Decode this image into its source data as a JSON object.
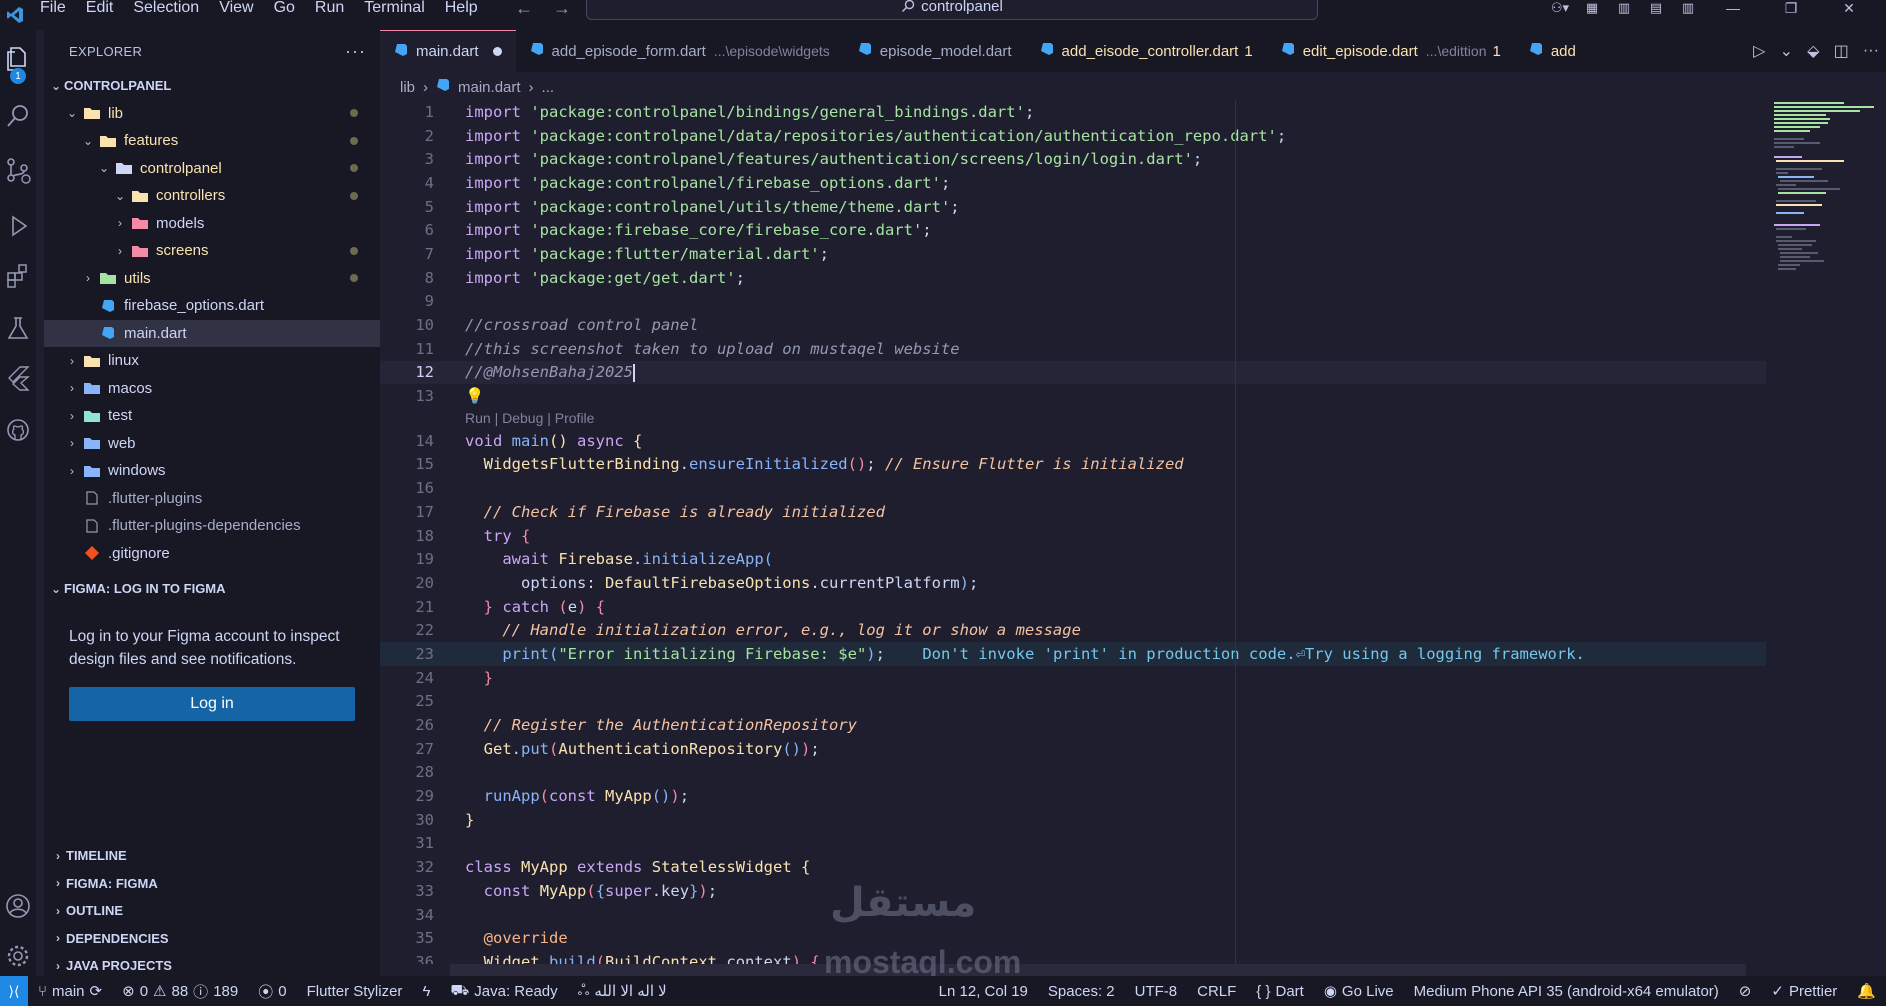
{
  "menu": [
    "File",
    "Edit",
    "Selection",
    "View",
    "Go",
    "Run",
    "Terminal",
    "Help"
  ],
  "command_center": "controlpanel",
  "activity_badge": "1",
  "explorer": {
    "title": "EXPLORER",
    "more": "···",
    "root": "CONTROLPANEL",
    "tree": [
      {
        "label": "lib",
        "depth": 0,
        "type": "folder",
        "open": true,
        "dot": true
      },
      {
        "label": "features",
        "depth": 1,
        "type": "folder",
        "open": true,
        "dot": true
      },
      {
        "label": "controlpanel",
        "depth": 2,
        "type": "folder",
        "open": true,
        "dot": true
      },
      {
        "label": "controllers",
        "depth": 3,
        "type": "folder",
        "open": true,
        "dot": true
      },
      {
        "label": "models",
        "depth": 3,
        "type": "folder",
        "open": false,
        "dot": false
      },
      {
        "label": "screens",
        "depth": 3,
        "type": "folder",
        "open": false,
        "dot": true
      },
      {
        "label": "utils",
        "depth": 1,
        "type": "folder",
        "open": false,
        "dot": true
      },
      {
        "label": "firebase_options.dart",
        "depth": 1,
        "type": "dart",
        "dot": false
      },
      {
        "label": "main.dart",
        "depth": 1,
        "type": "dart",
        "dot": false,
        "selected": true
      },
      {
        "label": "linux",
        "depth": 0,
        "type": "folder",
        "open": false
      },
      {
        "label": "macos",
        "depth": 0,
        "type": "folder",
        "open": false
      },
      {
        "label": "test",
        "depth": 0,
        "type": "folder",
        "open": false
      },
      {
        "label": "web",
        "depth": 0,
        "type": "folder",
        "open": false
      },
      {
        "label": "windows",
        "depth": 0,
        "type": "folder",
        "open": false
      },
      {
        "label": ".flutter-plugins",
        "depth": 0,
        "type": "file"
      },
      {
        "label": ".flutter-plugins-dependencies",
        "depth": 0,
        "type": "file"
      },
      {
        "label": ".gitignore",
        "depth": 0,
        "type": "git"
      }
    ]
  },
  "figma": {
    "title": "FIGMA: LOG IN TO FIGMA",
    "text": "Log in to your Figma account to inspect design files and see notifications.",
    "button": "Log in"
  },
  "bottom_sections": [
    "TIMELINE",
    "FIGMA: FIGMA",
    "OUTLINE",
    "DEPENDENCIES",
    "JAVA PROJECTS"
  ],
  "tabs": [
    {
      "label": "main.dart",
      "active": true,
      "modified": true
    },
    {
      "label": "add_episode_form.dart",
      "path": "...\\episode\\widgets"
    },
    {
      "label": "episode_model.dart"
    },
    {
      "label": "add_eisode_controller.dart",
      "num": "1",
      "warn": true
    },
    {
      "label": "edit_episode.dart",
      "path": "...\\edittion",
      "num": "1",
      "warn": true
    },
    {
      "label": "add"
    }
  ],
  "breadcrumb": [
    "lib",
    "main.dart",
    "..."
  ],
  "code": {
    "codelens": "Run | Debug | Profile",
    "warning_message": "Don't invoke 'print' in production code.⏎Try using a logging framework.",
    "current_line": "12"
  },
  "status": {
    "branch": "main",
    "errors": "0",
    "warnings": "88",
    "infos": "189",
    "ports": "0",
    "stylizer": "Flutter Stylizer",
    "java": "Java: Ready",
    "arabic": "لا اله الا الله",
    "position": "Ln 12, Col 19",
    "spaces": "Spaces: 2",
    "encoding": "UTF-8",
    "eol": "CRLF",
    "language": "Dart",
    "golive": "Go Live",
    "device": "Medium Phone API 35 (android-x64 emulator)",
    "prettier": "Prettier"
  },
  "watermark": {
    "arabic": "مستقل",
    "latin": "mostaql.com"
  }
}
